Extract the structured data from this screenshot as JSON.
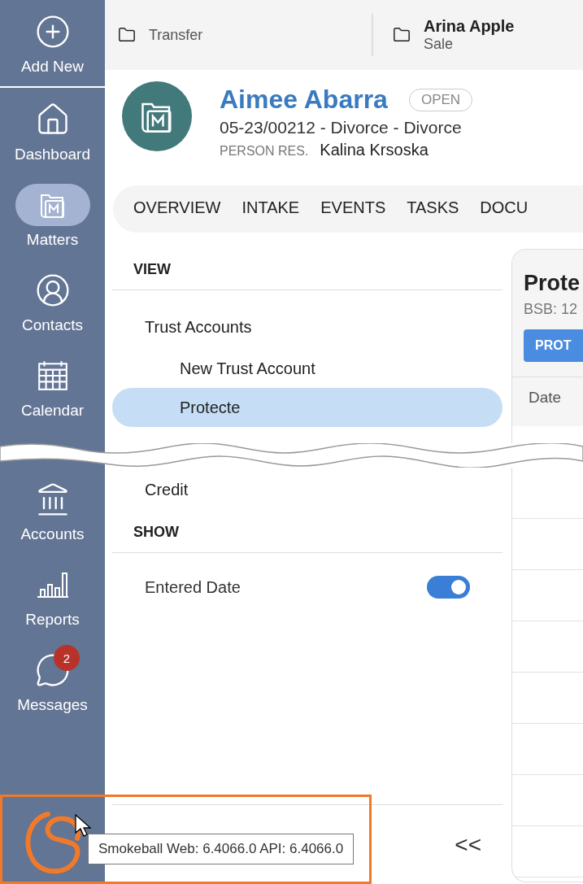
{
  "sidebar": {
    "items": [
      {
        "label": "Add New",
        "selected": false
      },
      {
        "label": "Dashboard",
        "selected": false
      },
      {
        "label": "Matters",
        "selected": true
      },
      {
        "label": "Contacts",
        "selected": false
      },
      {
        "label": "Calendar",
        "selected": false
      },
      {
        "label": "Accounts",
        "selected": false
      },
      {
        "label": "Reports",
        "selected": false
      },
      {
        "label": "Messages",
        "selected": false,
        "badge": "2"
      }
    ]
  },
  "top_bar": {
    "matters": [
      {
        "subtitle": "Transfer"
      },
      {
        "title": "Arina Apple",
        "subtitle": "Sale"
      }
    ]
  },
  "matter": {
    "name": "Aimee Abarra",
    "status": "OPEN",
    "reference": "05-23/00212 - Divorce - Divorce",
    "person_label": "PERSON RES.",
    "person": "Kalina Krsoska"
  },
  "tabs": [
    {
      "label": "OVERVIEW",
      "selected": false
    },
    {
      "label": "INTAKE",
      "selected": false
    },
    {
      "label": "EVENTS",
      "selected": false
    },
    {
      "label": "TASKS",
      "selected": false
    },
    {
      "label": "DOCU",
      "selected": false
    }
  ],
  "view_panel": {
    "view_heading": "VIEW",
    "items": [
      {
        "label": "Trust Accounts",
        "selected": false,
        "children": [
          {
            "label": "New Trust Account",
            "selected": false
          },
          {
            "label": "Protecte",
            "selected": true
          }
        ]
      },
      {
        "label": "Credit",
        "selected": false
      }
    ],
    "show_heading": "SHOW",
    "toggles": [
      {
        "label": "Entered Date",
        "on": true
      }
    ],
    "collapse": "<<"
  },
  "account_card": {
    "title": "Prote",
    "subtitle": "BSB: 12",
    "button": "PROT",
    "columns": [
      "Date"
    ]
  },
  "tooltip": "Smokeball Web: 6.4066.0 API: 6.4066.0"
}
